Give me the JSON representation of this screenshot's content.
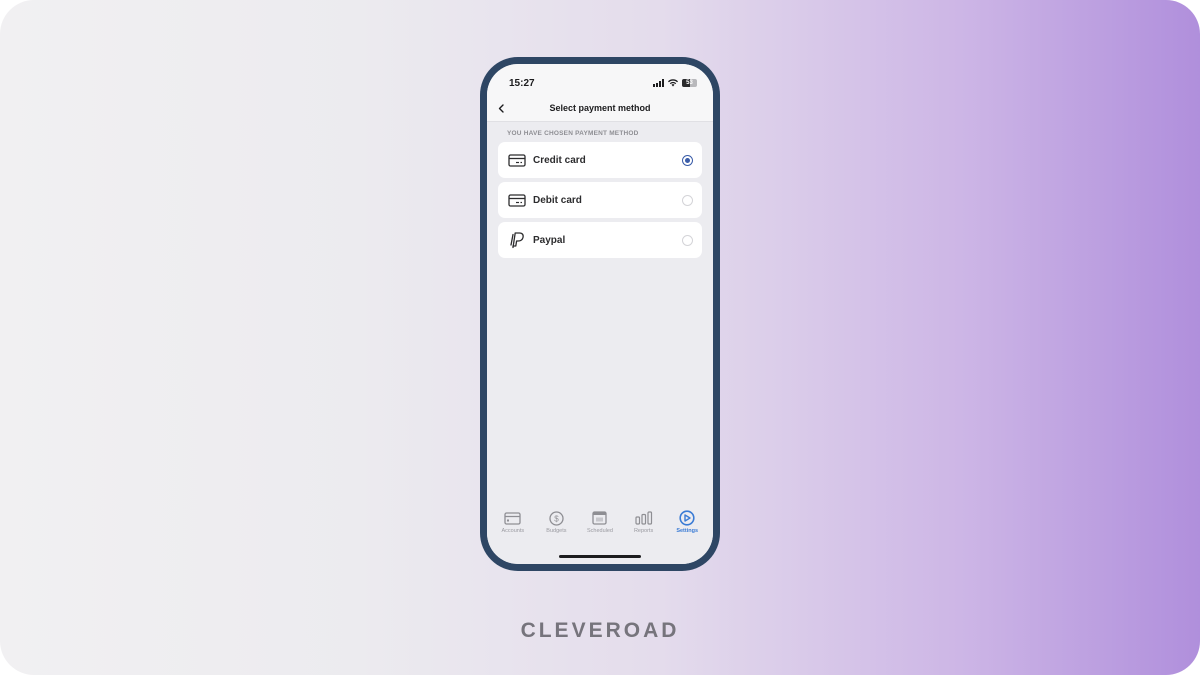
{
  "status_bar": {
    "time": "15:27",
    "battery_level": "53",
    "battery_fraction": 0.53
  },
  "nav": {
    "back_icon": "chevron-left-icon",
    "title": "Select payment method"
  },
  "section_label": "YOU HAVE CHOSEN PAYMENT METHOD",
  "payment_options": [
    {
      "label": "Credit card",
      "icon": "credit-card-icon",
      "selected": true
    },
    {
      "label": "Debit card",
      "icon": "debit-card-icon",
      "selected": false
    },
    {
      "label": "Paypal",
      "icon": "paypal-icon",
      "selected": false
    }
  ],
  "tab_bar": {
    "tabs": [
      {
        "label": "Accounts",
        "icon": "card-icon",
        "active": false
      },
      {
        "label": "Budgets",
        "icon": "dollar-circle-icon",
        "active": false
      },
      {
        "label": "Scheduled",
        "icon": "calendar-icon",
        "active": false
      },
      {
        "label": "Reports",
        "icon": "bar-chart-icon",
        "active": false
      },
      {
        "label": "Settings",
        "icon": "settings-icon",
        "active": true
      }
    ]
  },
  "colors": {
    "accent": "#3a7bd5",
    "radio_selected": "#3a5ca8",
    "phone_frame": "#2e4664"
  },
  "brand": "CLEVEROAD"
}
